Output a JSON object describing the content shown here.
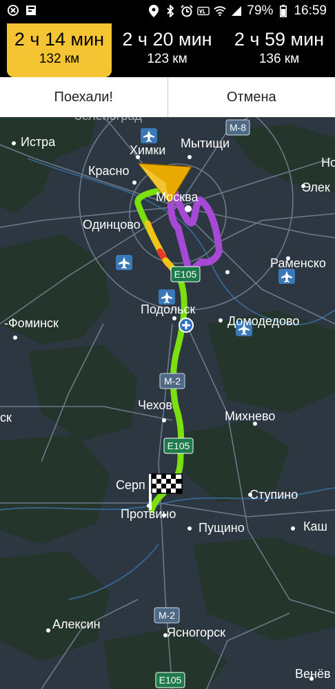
{
  "status_bar": {
    "battery": "79%",
    "time": "16:59",
    "icons": [
      "notification-icon",
      "news-icon",
      "location-icon",
      "bluetooth-icon",
      "alarm-icon",
      "volte-icon",
      "wifi-icon",
      "signal-icon",
      "battery-icon"
    ]
  },
  "routes": [
    {
      "time": "2 ч 14 мин",
      "distance": "132 км",
      "selected": true
    },
    {
      "time": "2 ч 20 мин",
      "distance": "123 км",
      "selected": false
    },
    {
      "time": "2 ч 59 мин",
      "distance": "136 км",
      "selected": false
    }
  ],
  "actions": {
    "go": "Поехали!",
    "cancel": "Отмена"
  },
  "map": {
    "cities": {
      "zelenograd": "Зеленоград",
      "istra": "Истра",
      "khimki": "Химки",
      "mytishchi": "Мытищи",
      "n_edge": "Но",
      "krasnogorsk": "Красно",
      "moskva": "Москва",
      "elektrostal": "Элек",
      "odintsovo": "Одинцово",
      "ramenskoe": "Раменско",
      "podolsk": "Подольск",
      "domodedovo": "Домодедово",
      "naro_fominsk": "-Фоминск",
      "chekhov": "Чехов",
      "mikhnevo": "Михнево",
      "sk_edge": "ск",
      "serpukhov": "Серп",
      "stupino": "Ступино",
      "protvino": "Протвино",
      "pushchino": "Пущино",
      "kashira": "Каш",
      "aleksin": "Алексин",
      "yasnogorsk": "Ясногорск",
      "venev": "Венёв"
    },
    "road_shields": {
      "m8": "М-8",
      "e105_top": "E105",
      "m2_top": "М-2",
      "e105_mid": "E105",
      "m2_bottom": "М-2",
      "e105_bottom": "E105"
    },
    "colors": {
      "route_fast": "#7cdf0e",
      "route_slow": "#f2c417",
      "route_jam": "#e83a2b",
      "route_alt": "#a64ad6",
      "highlight": "#f5c432"
    }
  }
}
